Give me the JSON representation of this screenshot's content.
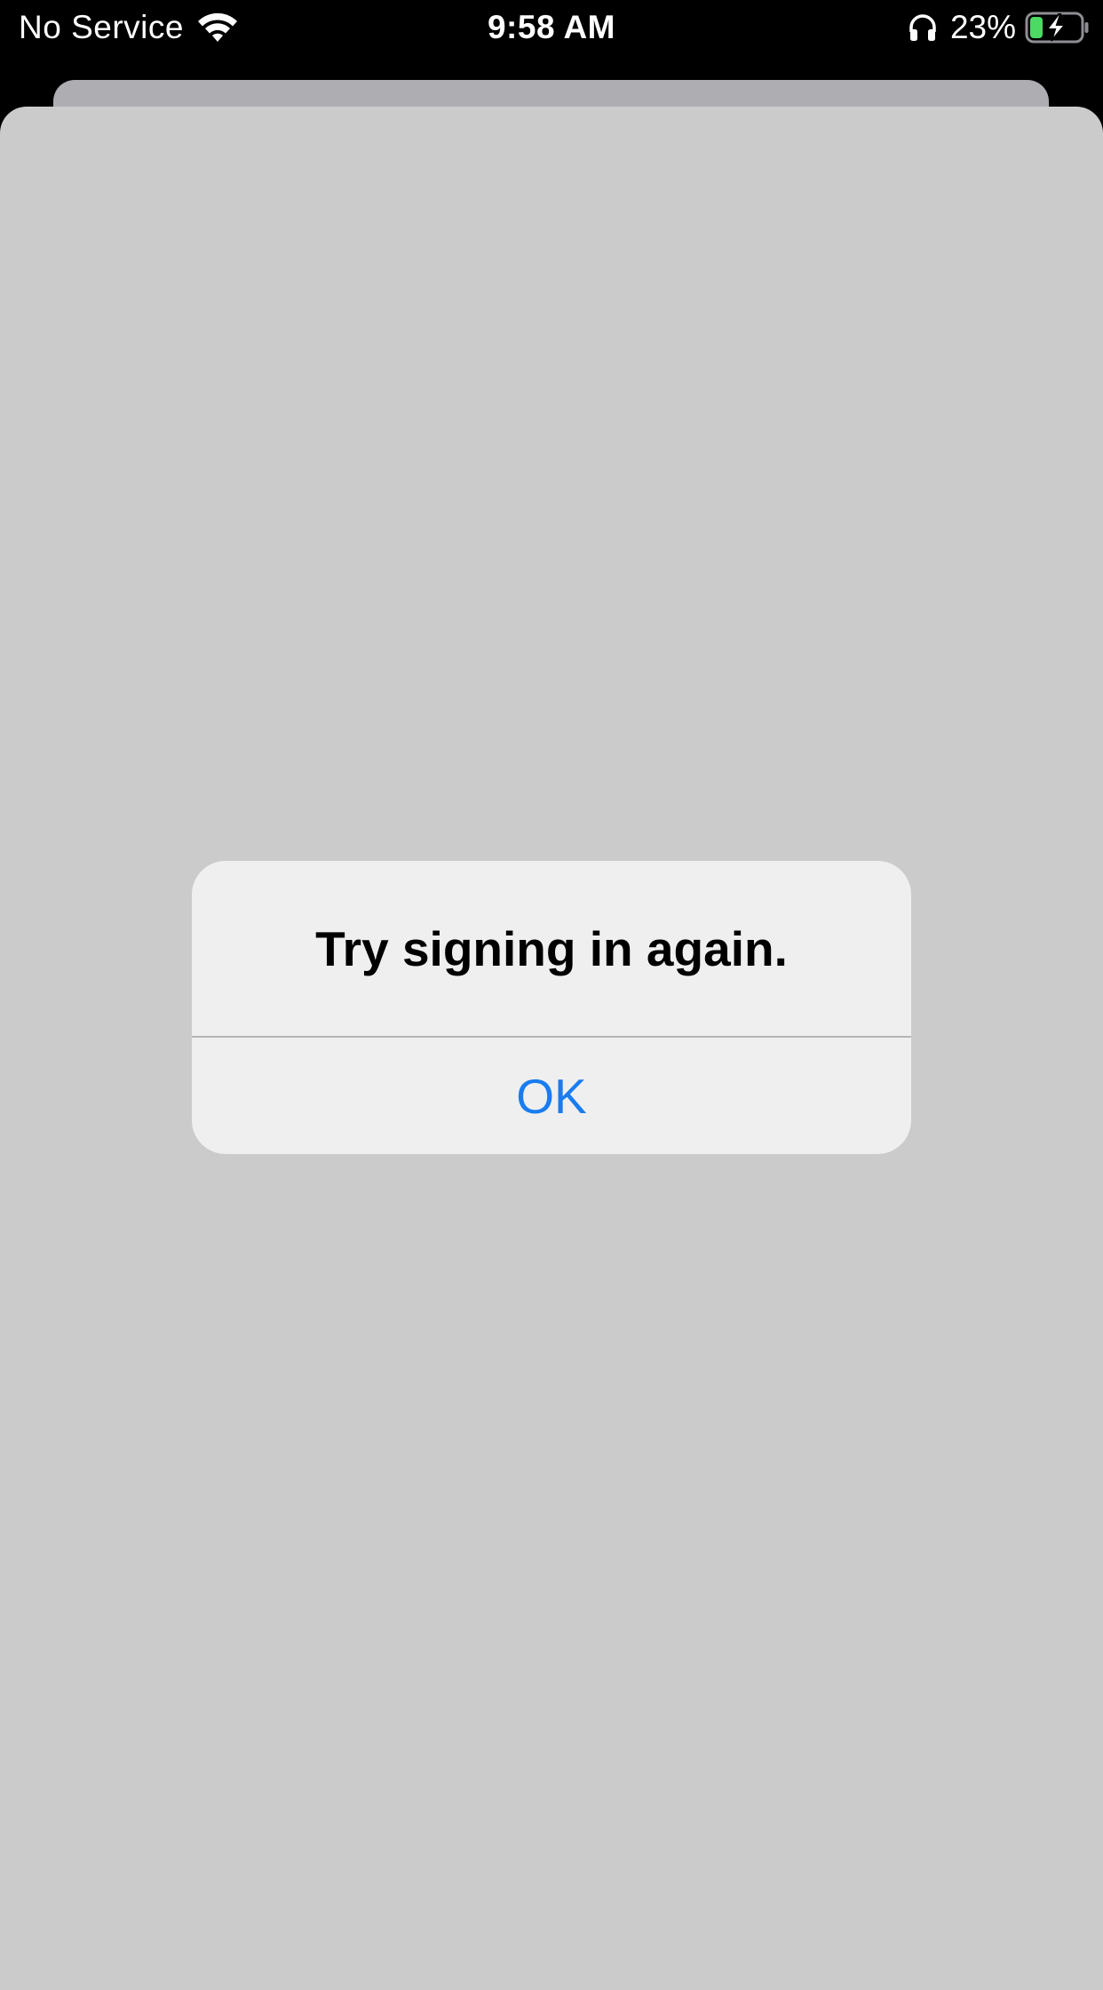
{
  "status_bar": {
    "carrier": "No Service",
    "time": "9:58 AM",
    "battery_percent": "23%",
    "battery_level": 0.23,
    "charging": true,
    "icons": [
      "wifi-icon",
      "headphones-icon",
      "battery-charging-icon"
    ]
  },
  "alert": {
    "title": "Try signing in again.",
    "ok_label": "OK"
  },
  "colors": {
    "sheet_background": "#cbcbcc",
    "alert_background": "#efeff0",
    "action_blue": "#1a7cf0",
    "battery_green": "#4cd964"
  }
}
